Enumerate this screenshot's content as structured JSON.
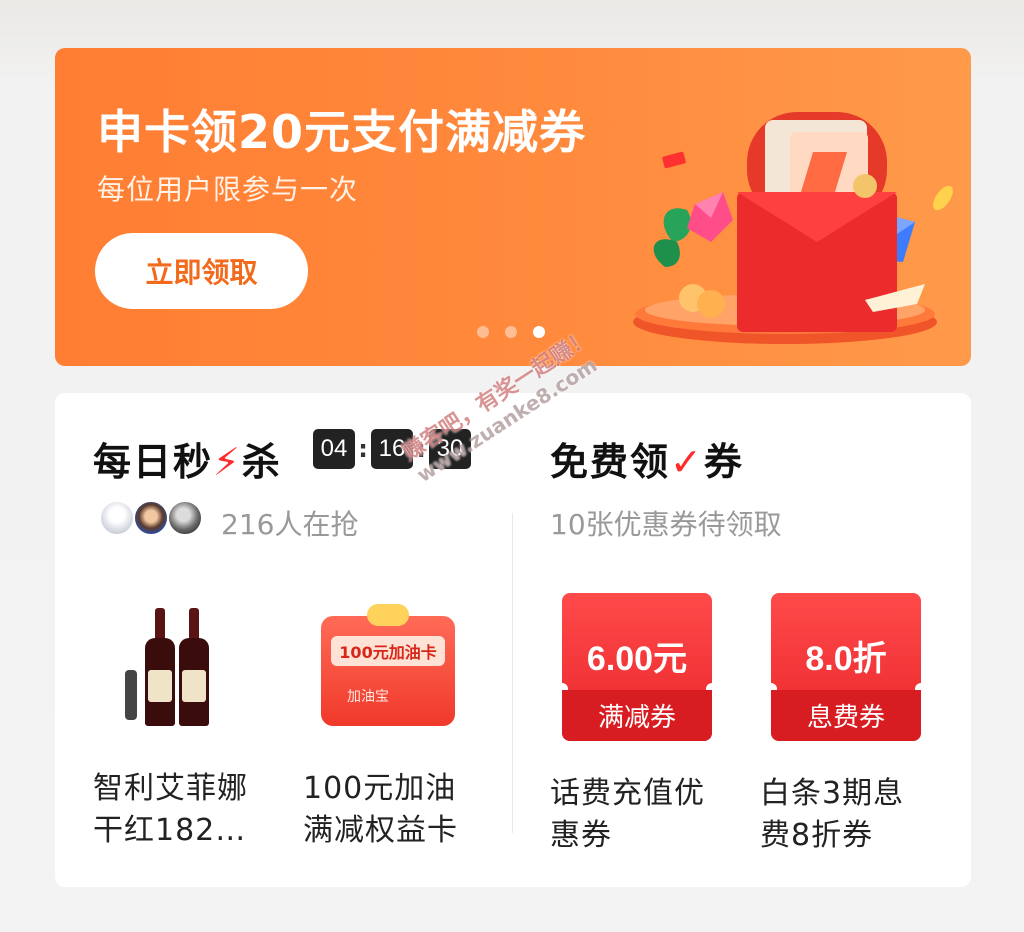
{
  "banner": {
    "title": "申卡领20元支付满减券",
    "subtitle": "每位用户限参与一次",
    "button_label": "立即领取",
    "dots": 3,
    "active_dot": 3
  },
  "flash_sale": {
    "title_main": "每日秒",
    "title_tail": "杀",
    "timer": [
      "04",
      "16",
      "30"
    ],
    "participants": "216人在抢",
    "products": [
      {
        "name_line1": "智利艾菲娜",
        "name_line2": "干红182…"
      },
      {
        "name_line1": "100元加油",
        "name_line2": "满减权益卡",
        "card_label": "100元加油卡",
        "card_brand": "加油宝"
      }
    ]
  },
  "coupons": {
    "title_main": "免费领",
    "title_tail": "券",
    "subtitle": "10张优惠券待领取",
    "items": [
      {
        "value": "6.00元",
        "type": "满减券",
        "name_line1": "话费充值优",
        "name_line2": "惠券"
      },
      {
        "value": "8.0折",
        "type": "息费券",
        "name_line1": "白条3期息",
        "name_line2": "费8折券"
      }
    ]
  },
  "watermark": {
    "line1": "赚客吧，有奖一起赚！",
    "line2": "www.zuanke8.com"
  },
  "colors": {
    "banner_orange": "#ff8a3d",
    "accent_red": "#e9262b",
    "button_text": "#f26a1c"
  },
  "icons": [
    "red-envelope-icon",
    "lightning-bolt-icon",
    "checkmark-icon",
    "wine-bottle-icon",
    "fuel-card-icon"
  ]
}
